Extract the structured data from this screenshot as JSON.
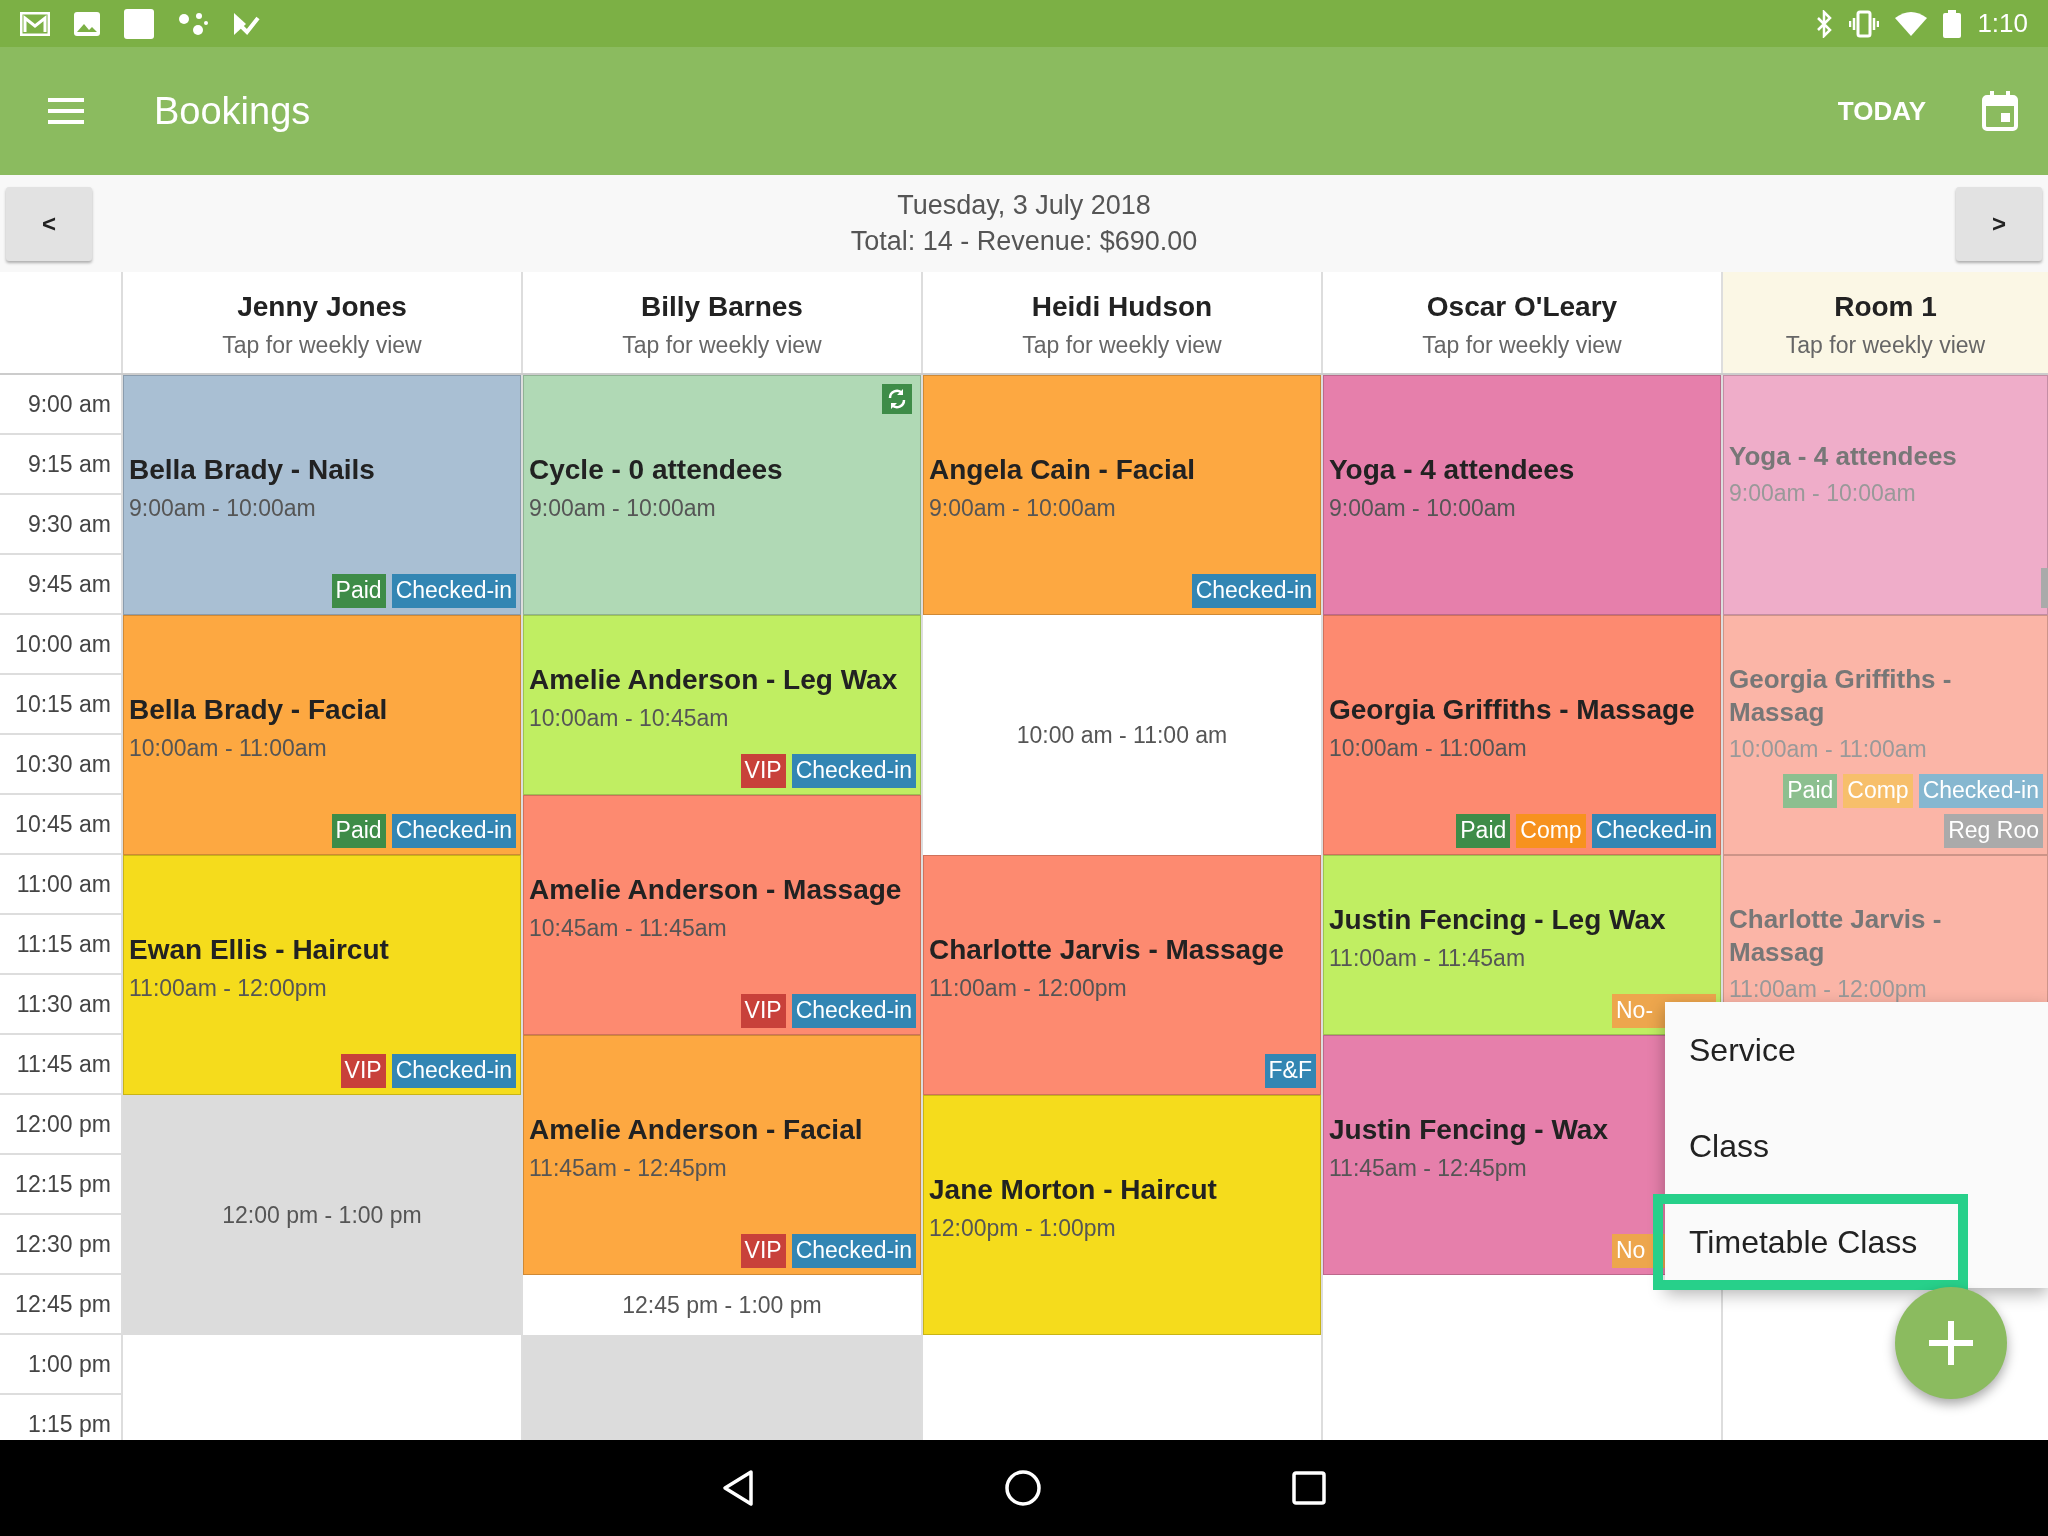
{
  "status_bar": {
    "time": "1:10"
  },
  "app_bar": {
    "title": "Bookings",
    "action": "TODAY"
  },
  "date_nav": {
    "prev": "<",
    "next": ">",
    "date": "Tuesday, 3 July 2018",
    "summary": "Total: 14 - Revenue: $690.00"
  },
  "time_labels": [
    "9:00 am",
    "9:15 am",
    "9:30 am",
    "9:45 am",
    "10:00 am",
    "10:15 am",
    "10:30 am",
    "10:45 am",
    "11:00 am",
    "11:15 am",
    "11:30 am",
    "11:45 am",
    "12:00 pm",
    "12:15 pm",
    "12:30 pm",
    "12:45 pm",
    "1:00 pm",
    "1:15 pm"
  ],
  "columns": [
    {
      "name": "Jenny Jones",
      "subtitle": "Tap for weekly view",
      "kind": "staff",
      "blocks": [
        {
          "kind": "booking",
          "title": "Bella Brady - Nails",
          "time": "9:00am - 10:00am",
          "color": "#a9bfd3",
          "tags": [
            {
              "text": "Paid",
              "color": "#3e8c48"
            },
            {
              "text": "Checked-in",
              "color": "#3386b3"
            }
          ]
        },
        {
          "kind": "booking",
          "title": "Bella Brady - Facial",
          "time": "10:00am - 11:00am",
          "color": "#fda841",
          "tags": [
            {
              "text": "Paid",
              "color": "#3e8c48"
            },
            {
              "text": "Checked-in",
              "color": "#3386b3"
            }
          ]
        },
        {
          "kind": "booking",
          "title": "Ewan Ellis - Haircut",
          "time": "11:00am - 12:00pm",
          "color": "#f5dc1c",
          "tags": [
            {
              "text": "VIP",
              "color": "#c8413a"
            },
            {
              "text": "Checked-in",
              "color": "#3386b3"
            }
          ]
        },
        {
          "kind": "free",
          "time": "12:00 pm - 1:00 pm",
          "color": "#dcdcdc"
        }
      ]
    },
    {
      "name": "Billy Barnes",
      "subtitle": "Tap for weekly view",
      "kind": "staff",
      "blocks": [
        {
          "kind": "booking",
          "title": "Cycle - 0 attendees",
          "time": "9:00am - 10:00am",
          "color": "#b0d9b5",
          "recurring": true
        },
        {
          "kind": "booking",
          "title": "Amelie Anderson - Leg Wax",
          "time": "10:00am - 10:45am",
          "color": "#c0ee62",
          "tags": [
            {
              "text": "VIP",
              "color": "#c8413a"
            },
            {
              "text": "Checked-in",
              "color": "#3386b3"
            }
          ]
        },
        {
          "kind": "booking",
          "title": "Amelie Anderson - Massage",
          "time": "10:45am - 11:45am",
          "color": "#fd8a70",
          "tags": [
            {
              "text": "VIP",
              "color": "#c8413a"
            },
            {
              "text": "Checked-in",
              "color": "#3386b3"
            }
          ]
        },
        {
          "kind": "booking",
          "title": "Amelie Anderson - Facial",
          "time": "11:45am - 12:45pm",
          "color": "#fda841",
          "tags": [
            {
              "text": "VIP",
              "color": "#c8413a"
            },
            {
              "text": "Checked-in",
              "color": "#3386b3"
            }
          ]
        },
        {
          "kind": "free",
          "time": "12:45 pm - 1:00 pm",
          "color": "#ffffff"
        },
        {
          "kind": "closed",
          "color": "#dcdcdc"
        }
      ]
    },
    {
      "name": "Heidi Hudson",
      "subtitle": "Tap for weekly view",
      "kind": "staff",
      "blocks": [
        {
          "kind": "booking",
          "title": "Angela Cain - Facial",
          "time": "9:00am - 10:00am",
          "color": "#fda841",
          "tags": [
            {
              "text": "Checked-in",
              "color": "#3386b3"
            }
          ]
        },
        {
          "kind": "free",
          "time": "10:00 am - 11:00 am",
          "color": "#ffffff"
        },
        {
          "kind": "booking",
          "title": "Charlotte Jarvis - Massage",
          "time": "11:00am - 12:00pm",
          "color": "#fd8a70",
          "tags": [
            {
              "text": "F&F",
              "color": "#3386b3"
            }
          ]
        },
        {
          "kind": "booking",
          "title": "Jane Morton - Haircut",
          "time": "12:00pm - 1:00pm",
          "color": "#f5dc1c"
        }
      ]
    },
    {
      "name": "Oscar O'Leary",
      "subtitle": "Tap for weekly view",
      "kind": "staff",
      "blocks": [
        {
          "kind": "booking",
          "title": "Yoga - 4 attendees",
          "time": "9:00am - 10:00am",
          "color": "#e67fab"
        },
        {
          "kind": "booking",
          "title": "Georgia Griffiths - Massage",
          "time": "10:00am - 11:00am",
          "color": "#fd8a70",
          "tags": [
            {
              "text": "Paid",
              "color": "#3e8c48"
            },
            {
              "text": "Comp",
              "color": "#f7921e"
            },
            {
              "text": "Checked-in",
              "color": "#3386b3"
            }
          ]
        },
        {
          "kind": "booking",
          "title": "Justin Fencing - Leg Wax",
          "time": "11:00am - 11:45am",
          "color": "#c0ee62",
          "tags": [
            {
              "text": "No-",
              "color": "#eda64d",
              "covered": true
            }
          ]
        },
        {
          "kind": "booking",
          "title": "Justin Fencing - Wax",
          "time": "11:45am - 12:45pm",
          "color": "#e67fab",
          "tags": [
            {
              "text": "No",
              "color": "#eda64d",
              "covered": true
            }
          ]
        }
      ]
    },
    {
      "name": "Room 1",
      "subtitle": "Tap for weekly view",
      "kind": "room",
      "blocks": [
        {
          "kind": "booking",
          "title": "Yoga - 4 attendees",
          "time": "9:00am - 10:00am",
          "color": "#efadc9",
          "tags": [
            {
              "color": "#aaaaaa"
            }
          ]
        },
        {
          "kind": "booking",
          "title": "Georgia Griffiths - Massag",
          "time": "10:00am - 11:00am",
          "color": "#fbb5a7",
          "tags": [
            {
              "text": "Paid",
              "color": "#8cbf8f"
            },
            {
              "text": "Comp",
              "color": "#f7bf6b"
            },
            {
              "text": "Checked-in",
              "color": "#86b7d0"
            },
            {
              "text": "Reg Roo",
              "color": "#aaaaaa"
            }
          ]
        },
        {
          "kind": "booking",
          "title": "Charlotte Jarvis - Massag",
          "time": "11:00am - 12:00pm",
          "color": "#fbb5a7"
        }
      ]
    }
  ],
  "menu": {
    "items": [
      {
        "label": "Service",
        "selected": false
      },
      {
        "label": "Class",
        "selected": false
      },
      {
        "label": "Timetable Class",
        "selected": true
      }
    ]
  }
}
